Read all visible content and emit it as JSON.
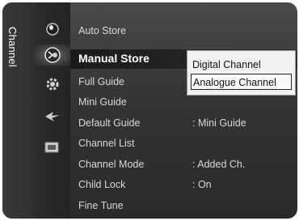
{
  "side_tab": {
    "label": "Channel"
  },
  "icons": [
    {
      "name": "picture-icon"
    },
    {
      "name": "channel-icon",
      "active": true
    },
    {
      "name": "setup-icon"
    },
    {
      "name": "input-icon"
    },
    {
      "name": "application-icon"
    }
  ],
  "menu": {
    "items": [
      {
        "label": "Auto Store",
        "value": ""
      },
      {
        "label": "Manual Store",
        "value": "",
        "selected": true
      },
      {
        "label": "Full Guide",
        "value": ""
      },
      {
        "label": "Mini Guide",
        "value": ""
      },
      {
        "label": "Default Guide",
        "value": ": Mini Guide"
      },
      {
        "label": "Channel List",
        "value": ""
      },
      {
        "label": "Channel Mode",
        "value": ": Added Ch."
      },
      {
        "label": "Child Lock",
        "value": ": On"
      },
      {
        "label": "Fine Tune",
        "value": ""
      }
    ]
  },
  "submenu": {
    "items": [
      {
        "label": "Digital Channel",
        "focused": false
      },
      {
        "label": "Analogue Channel",
        "focused": true
      }
    ]
  },
  "colors": {
    "panel": "#343434",
    "menu_text": "#d8d8d8",
    "selected_text": "#ffffff",
    "submenu_bg": "#f1f1f1"
  }
}
